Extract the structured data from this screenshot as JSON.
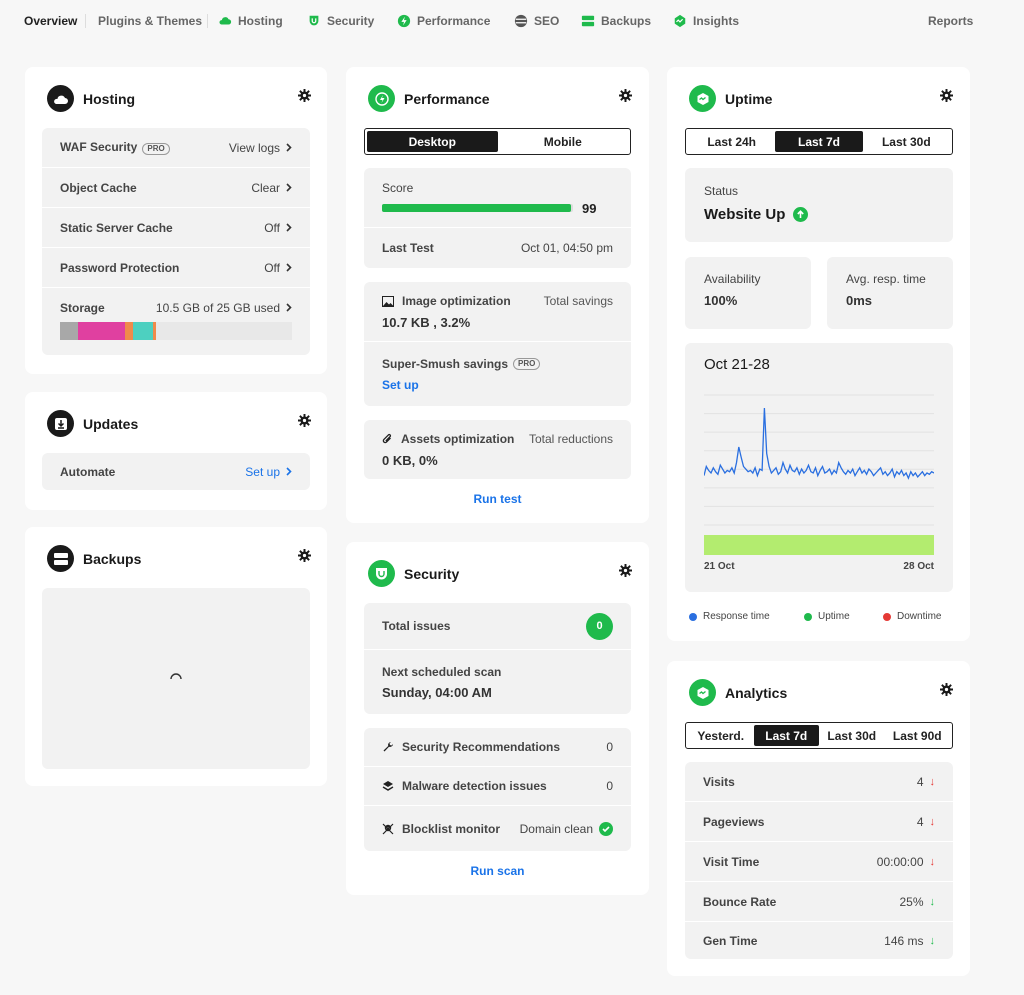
{
  "nav": {
    "overview": "Overview",
    "plugins": "Plugins & Themes",
    "hosting": "Hosting",
    "security": "Security",
    "performance": "Performance",
    "seo": "SEO",
    "backups": "Backups",
    "insights": "Insights",
    "reports": "Reports"
  },
  "hosting": {
    "title": "Hosting",
    "rows": [
      {
        "label": "WAF Security",
        "badge": "PRO",
        "value": "View logs"
      },
      {
        "label": "Object Cache",
        "value": "Clear"
      },
      {
        "label": "Static Server Cache",
        "value": "Off"
      },
      {
        "label": "Password Protection",
        "value": "Off"
      },
      {
        "label": "Storage",
        "value": "10.5 GB of 25 GB used"
      }
    ],
    "storage_colors": [
      "#a8a8a8",
      "#e040a0",
      "#f08a4b",
      "#4dd0c0",
      "#f08a4b"
    ]
  },
  "updates": {
    "title": "Updates",
    "row_label": "Automate",
    "row_value": "Set up"
  },
  "backups": {
    "title": "Backups"
  },
  "performance": {
    "title": "Performance",
    "tabs": [
      "Desktop",
      "Mobile"
    ],
    "score_label": "Score",
    "score": "99",
    "score_fraction": 0.99,
    "last_test_label": "Last Test",
    "last_test_value": "Oct 01, 04:50 pm",
    "image_opt_label": "Image optimization",
    "image_opt_right": "Total savings",
    "image_opt_value": "10.7 KB , 3.2%",
    "smush_label": "Super-Smush savings",
    "smush_badge": "PRO",
    "smush_link": "Set up",
    "assets_label": "Assets optimization",
    "assets_right": "Total reductions",
    "assets_value": "0 KB, 0%",
    "run_test": "Run test"
  },
  "security": {
    "title": "Security",
    "total_issues_label": "Total issues",
    "total_issues": "0",
    "next_scan_label": "Next scheduled scan",
    "next_scan_value": "Sunday, 04:00 AM",
    "rows": [
      {
        "label": "Security Recommendations",
        "value": "0"
      },
      {
        "label": "Malware detection issues",
        "value": "0"
      },
      {
        "label": "Blocklist monitor",
        "value": "Domain clean"
      }
    ],
    "run_scan": "Run scan"
  },
  "uptime": {
    "title": "Uptime",
    "tabs": [
      "Last 24h",
      "Last 7d",
      "Last 30d"
    ],
    "status_label": "Status",
    "status_value": "Website Up",
    "availability_label": "Availability",
    "availability_value": "100%",
    "resp_label": "Avg. resp. time",
    "resp_value": "0ms",
    "chart_title": "Oct 21-28",
    "x_start": "21 Oct",
    "x_end": "28 Oct",
    "legend": [
      {
        "label": "Response time",
        "color": "#2a6fe0"
      },
      {
        "label": "Uptime",
        "color": "#1fba4c"
      },
      {
        "label": "Downtime",
        "color": "#e53935"
      }
    ]
  },
  "analytics": {
    "title": "Analytics",
    "tabs": [
      "Yesterd.",
      "Last 7d",
      "Last 30d",
      "Last 90d"
    ],
    "rows": [
      {
        "label": "Visits",
        "value": "4",
        "trend": "down",
        "color": "#e53935"
      },
      {
        "label": "Pageviews",
        "value": "4",
        "trend": "down",
        "color": "#e53935"
      },
      {
        "label": "Visit Time",
        "value": "00:00:00",
        "trend": "down",
        "color": "#e53935"
      },
      {
        "label": "Bounce Rate",
        "value": "25%",
        "trend": "down",
        "color": "#1fba4c"
      },
      {
        "label": "Gen Time",
        "value": "146 ms",
        "trend": "down",
        "color": "#1fba4c"
      }
    ]
  },
  "chart_data": {
    "type": "line",
    "title": "Oct 21-28",
    "xlabel": "",
    "ylabel": "",
    "x_ticks": [
      "21 Oct",
      "28 Oct"
    ],
    "series": [
      {
        "name": "Response time",
        "values": [
          38,
          45,
          42,
          40,
          44,
          41,
          39,
          46,
          43,
          40,
          42,
          41,
          44,
          40,
          48,
          60,
          52,
          45,
          43,
          41,
          42,
          40,
          44,
          38,
          43,
          42,
          90,
          55,
          45,
          40,
          42,
          44,
          39,
          41,
          48,
          43,
          40,
          46,
          42,
          41,
          44,
          39,
          43,
          40,
          42,
          46,
          41,
          40,
          44,
          38,
          42,
          45,
          40,
          41,
          43,
          39,
          42,
          40,
          48,
          44,
          41,
          39,
          42,
          40,
          43,
          38,
          41,
          44,
          40,
          42,
          39,
          43,
          41,
          38,
          40,
          42,
          44,
          39,
          41,
          38,
          40,
          43,
          37,
          41,
          39,
          42,
          38,
          40,
          36,
          41,
          38,
          40,
          37,
          39,
          41,
          38,
          40,
          39,
          41,
          40
        ]
      }
    ]
  }
}
